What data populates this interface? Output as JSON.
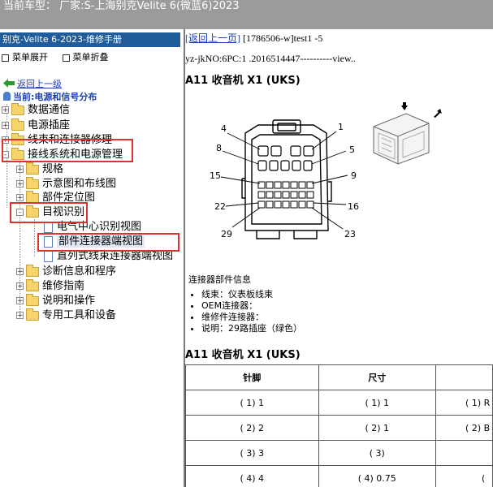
{
  "topbar": {
    "title": "当前车型： 厂家:S-上海别克Velite 6(微蓝6)2023"
  },
  "left": {
    "header": "别克-Velite 6-2023-维修手册",
    "expand_all": "菜单展开",
    "collapse_all": "菜单折叠",
    "back": "返回上一级",
    "current": "当前:电源和信号分布",
    "tree": [
      {
        "label": "数据通信",
        "exp": "+"
      },
      {
        "label": "电源插座",
        "exp": "+"
      },
      {
        "label": "线束和连接器修理",
        "exp": "+"
      },
      {
        "label": "接线系统和电源管理",
        "exp": "-"
      },
      {
        "label": "规格",
        "exp": "+"
      },
      {
        "label": "示意图和布线图",
        "exp": "+"
      },
      {
        "label": "部件定位图",
        "exp": "+"
      },
      {
        "label": "目视识别",
        "exp": "-"
      },
      {
        "label": "电气中心识别视图"
      },
      {
        "label": "部件连接器端视图"
      },
      {
        "label": "直列式线束连接器端视图"
      },
      {
        "label": "诊断信息和程序",
        "exp": "+"
      },
      {
        "label": "维修指南",
        "exp": "+"
      },
      {
        "label": "说明和操作",
        "exp": "+"
      },
      {
        "label": "专用工具和设备",
        "exp": "+"
      }
    ]
  },
  "right": {
    "back_link": "[返回上一页]",
    "doc_id": " [1786506-w]test1 -5",
    "meta": "yz-jkNO:6PC:1 .2016514447----------view..",
    "heading1": "A11 收音机 X1 (UKS)",
    "pin_labels": {
      "p4": "4",
      "p1": "1",
      "p8": "8",
      "p5": "5",
      "p15": "15",
      "p9": "9",
      "p22": "22",
      "p16": "16",
      "p29": "29",
      "p23": "23"
    },
    "info_title": "连接器部件信息",
    "info_items": [
      "线束：仪表板线束",
      "OEM连接器：",
      "维修件连接器：",
      "说明：29路插座（绿色）"
    ],
    "heading2": "A11 收音机 X1 (UKS)",
    "table": {
      "headers": [
        "针脚",
        "尺寸",
        ""
      ],
      "rows": [
        [
          "( 1) 1",
          "( 1) 1",
          "( 1) R"
        ],
        [
          "( 2) 2",
          "( 2) 1",
          "( 2) B"
        ],
        [
          "( 3) 3",
          "( 3)",
          ""
        ],
        [
          "( 4) 4",
          "( 4) 0.75",
          "("
        ]
      ]
    }
  }
}
